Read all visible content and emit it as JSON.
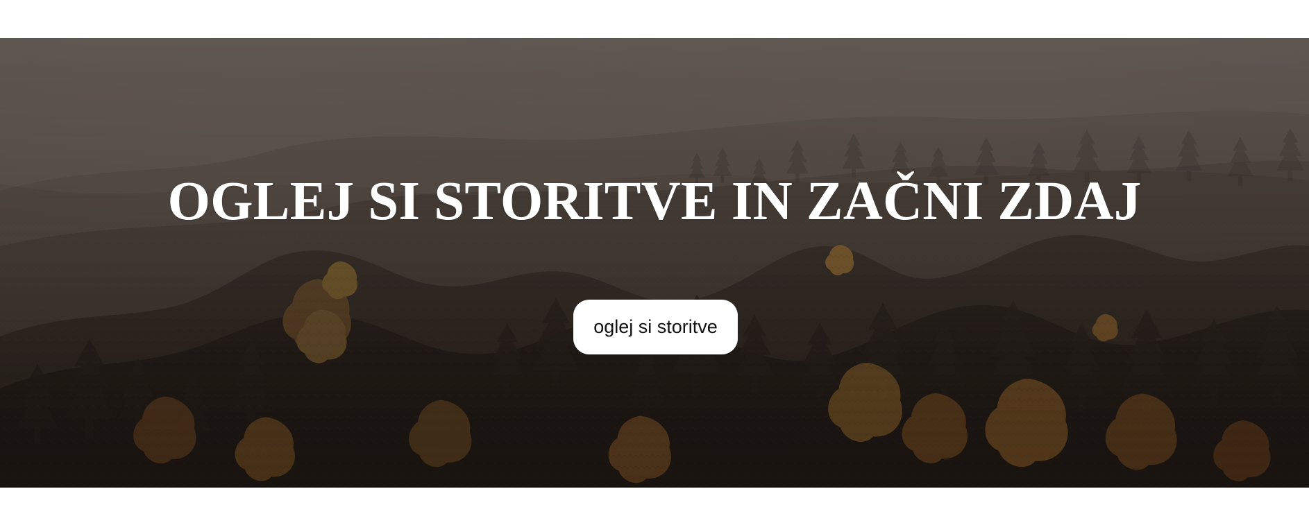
{
  "hero": {
    "title": "OGLEJ SI STORITVE IN ZAČNI ZDAJ",
    "button_label": "oglej si storitve",
    "background": "misty autumn forest",
    "text_color": "#ffffff",
    "button_color": "#ffffff",
    "button_text_color": "#111111"
  }
}
